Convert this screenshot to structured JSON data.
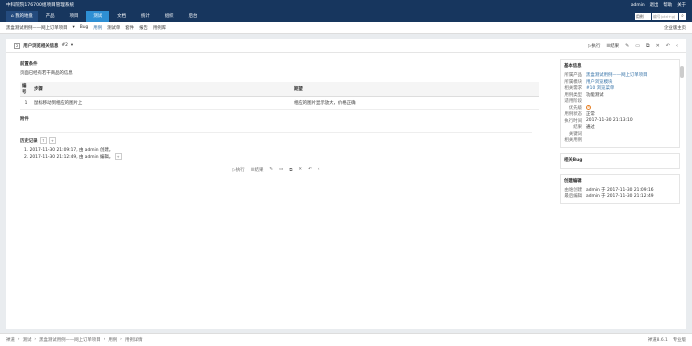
{
  "topbar": {
    "brand": "中科院院176700组项目管理系统",
    "user": "admin",
    "exit": "退出",
    "help": "帮助",
    "about": "关于"
  },
  "nav": {
    "home": "我的地盘",
    "tabs": [
      "产品",
      "项目",
      "测试",
      "文档",
      "统计",
      "组织",
      "后台"
    ],
    "active": 2,
    "search_select": "用例",
    "search_placeholder": "编号(ctrl+g)"
  },
  "subnav": {
    "product": "黑盒测试用例——网上订单项目",
    "items": [
      "Bug",
      "用例",
      "测试单",
      "套件",
      "报告",
      "用例库"
    ],
    "current": 1,
    "right": "企业版主页"
  },
  "title": {
    "badge": "2",
    "text": "用户浏览相关信息",
    "version": "#2",
    "exec": "执行",
    "result": "结果"
  },
  "precondition": {
    "label": "前置条件",
    "text": "页面已经有若干商品的信息"
  },
  "steps": {
    "headers": [
      "编号",
      "步骤",
      "期望"
    ],
    "rows": [
      {
        "num": "1",
        "step": "鼠标移动到相应的图片上",
        "expect": "相应的图片显示放大，价格正确"
      }
    ]
  },
  "attachments": {
    "label": "附件"
  },
  "history": {
    "label": "历史记录",
    "items": [
      "1. 2017-11-30 21:09:17, 由 admin 创建。",
      "2. 2017-11-30 21:12:49, 由 admin 编辑。"
    ]
  },
  "actions": {
    "exec": "执行",
    "result": "结果"
  },
  "basic": {
    "head": "基本信息",
    "rows": [
      {
        "k": "所属产品",
        "v": "黑盒测试用例——网上订单项目",
        "link": true
      },
      {
        "k": "所属模块",
        "v": "用户浏览模块",
        "link": true
      },
      {
        "k": "相关需求",
        "v": "#10 浏览菜单",
        "link": true
      },
      {
        "k": "用例类型",
        "v": "功能测试",
        "link": false
      },
      {
        "k": "适用阶段",
        "v": "",
        "link": false
      },
      {
        "k": "优先级",
        "v": "3",
        "link": false
      },
      {
        "k": "用例状态",
        "v": "正常",
        "link": false
      },
      {
        "k": "执行时间",
        "v": "2017-11-30 21:13:10",
        "link": false
      },
      {
        "k": "结果",
        "v": "通过",
        "link": false
      },
      {
        "k": "关键词",
        "v": "",
        "link": false
      },
      {
        "k": "相关用例",
        "v": "",
        "link": false
      }
    ]
  },
  "related_bug": {
    "head": "相关Bug"
  },
  "creator": {
    "head": "创建编辑",
    "rows": [
      {
        "k": "由谁创建",
        "v": "admin 于 2017-11-30 21:09:16"
      },
      {
        "k": "最后编辑",
        "v": "admin 于 2017-11-30 21:12:49"
      }
    ]
  },
  "footer": {
    "crumbs": [
      "禅道",
      "测试",
      "黑盒测试用例——网上订单项目",
      "用例",
      "用例详情"
    ],
    "version": "禅道8.6.1",
    "site": "专业版"
  }
}
